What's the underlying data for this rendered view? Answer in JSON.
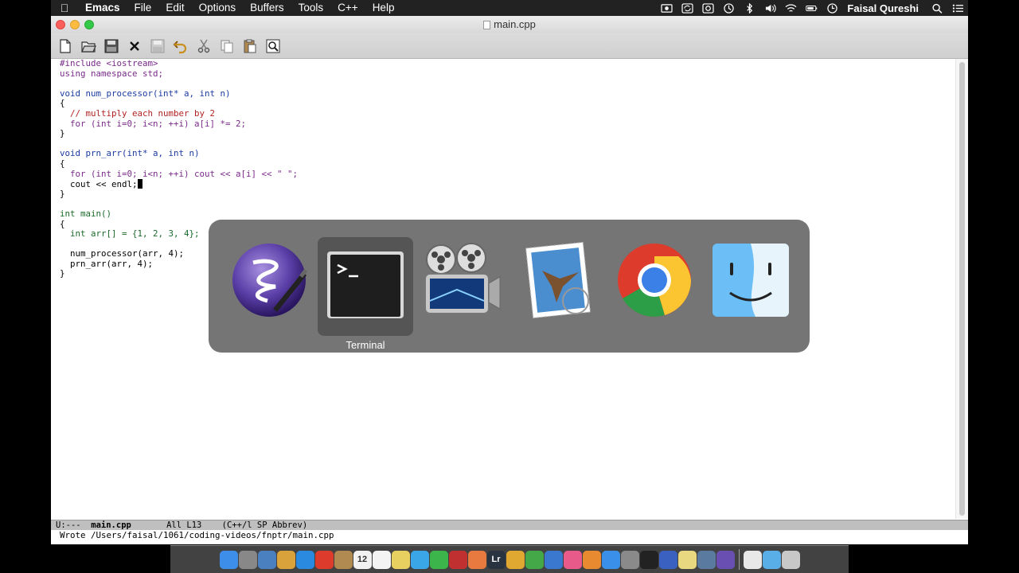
{
  "menubar": {
    "app": "Emacs",
    "items": [
      "File",
      "Edit",
      "Options",
      "Buffers",
      "Tools",
      "C++",
      "Help"
    ],
    "user": "Faisal Qureshi",
    "status_icons": [
      "screen-record-icon",
      "sync-icon",
      "camera-icon",
      "time-machine-icon",
      "bluetooth-icon",
      "volume-icon",
      "wifi-icon",
      "battery-icon",
      "clock-icon",
      "spotlight-search-icon",
      "notification-center-icon"
    ]
  },
  "window": {
    "title": "main.cpp",
    "toolbar": [
      "new-file-icon",
      "open-folder-icon",
      "save-disk-icon",
      "close-x-icon",
      "save-as-icon",
      "undo-icon",
      "cut-icon",
      "copy-icon",
      "paste-icon",
      "search-icon"
    ]
  },
  "editor": {
    "lines": [
      "#include <iostream>",
      "using namespace std;",
      "",
      "void num_processor(int* a, int n)",
      "{",
      "  // multiply each number by 2",
      "  for (int i=0; i<n; ++i) a[i] *= 2;",
      "}",
      "",
      "void prn_arr(int* a, int n)",
      "{",
      "  for (int i=0; i<n; ++i) cout << a[i] << \" \";",
      "  cout << endl;",
      "}",
      "",
      "int main()",
      "{",
      "  int arr[] = {1, 2, 3, 4};",
      "",
      "  num_processor(arr, 4);",
      "  prn_arr(arr, 4);",
      "}"
    ]
  },
  "modeline": {
    "status": "U:---",
    "buffer": "main.cpp",
    "position": "All L13",
    "modes": "(C++/l SP Abbrev)"
  },
  "echo_area": "Wrote /Users/faisal/1061/coding-videos/fnptr/main.cpp",
  "app_switcher": {
    "apps": [
      {
        "name": "Emacs",
        "icon": "emacs-icon"
      },
      {
        "name": "Terminal",
        "icon": "terminal-icon"
      },
      {
        "name": "iMovie",
        "icon": "imovie-icon"
      },
      {
        "name": "Mail",
        "icon": "mail-icon"
      },
      {
        "name": "Chrome",
        "icon": "chrome-icon"
      },
      {
        "name": "Finder",
        "icon": "finder-icon"
      }
    ],
    "selected_label": "Terminal"
  },
  "dock": {
    "calendar_day": "12",
    "lightroom_label": "Lr",
    "colors": {
      "finder": "#3d8ee8",
      "safari": "#2a8ae0",
      "chrome": "#dd3b2c",
      "terminal": "#222222",
      "emacs": "#6a4fb3"
    }
  }
}
